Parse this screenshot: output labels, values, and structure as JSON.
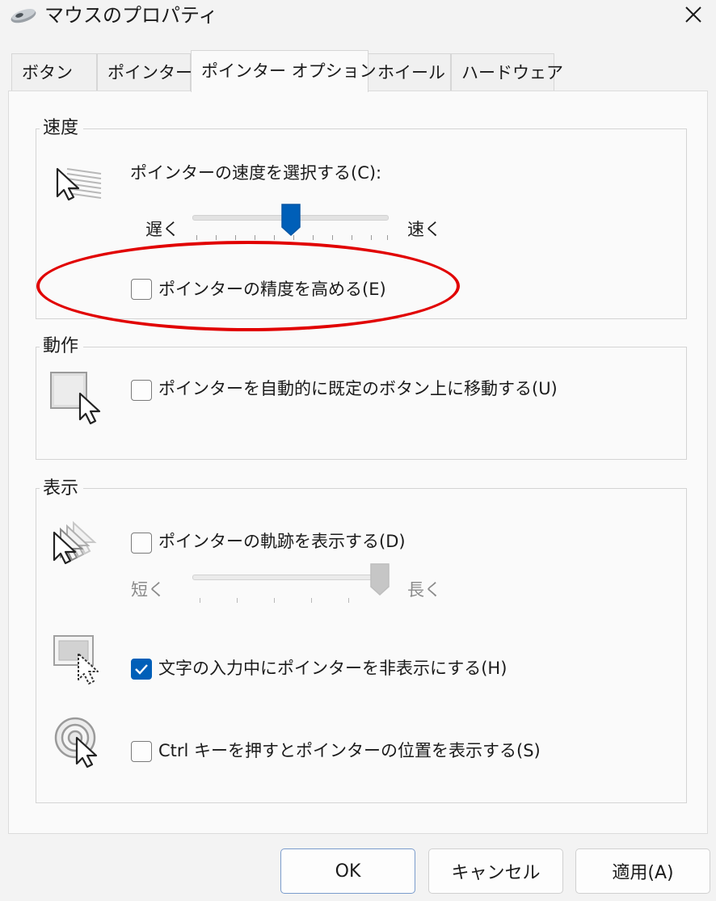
{
  "window": {
    "title": "マウスのプロパティ",
    "app_icon": "mouse-icon",
    "close_icon": "close-icon"
  },
  "tabs": [
    {
      "label": "ボタン",
      "active": false
    },
    {
      "label": "ポインター",
      "active": false
    },
    {
      "label": "ポインター オプション",
      "active": true
    },
    {
      "label": "ホイール",
      "active": false
    },
    {
      "label": "ハードウェア",
      "active": false
    }
  ],
  "speed": {
    "group_title": "速度",
    "select_label": "ポインターの速度を選択する(C):",
    "slow_label": "遅く",
    "fast_label": "速く",
    "slider_value_fraction": 0.5,
    "precision_label": "ポインターの精度を高める(E)",
    "precision_checked": false
  },
  "motion": {
    "group_title": "動作",
    "snap_label": "ポインターを自動的に既定のボタン上に移動する(U)",
    "snap_checked": false
  },
  "visibility": {
    "group_title": "表示",
    "trails_label": "ポインターの軌跡を表示する(D)",
    "trails_checked": false,
    "trails_short_label": "短く",
    "trails_long_label": "長く",
    "trails_slider_value_fraction": 1.0,
    "hide_label": "文字の入力中にポインターを非表示にする(H)",
    "hide_checked": true,
    "ctrl_label": "Ctrl キーを押すとポインターの位置を表示する(S)",
    "ctrl_checked": false
  },
  "buttons": {
    "ok": "OK",
    "cancel": "キャンセル",
    "apply": "適用(A)"
  },
  "colors": {
    "accent": "#005fb8",
    "highlight": "#e10000"
  }
}
